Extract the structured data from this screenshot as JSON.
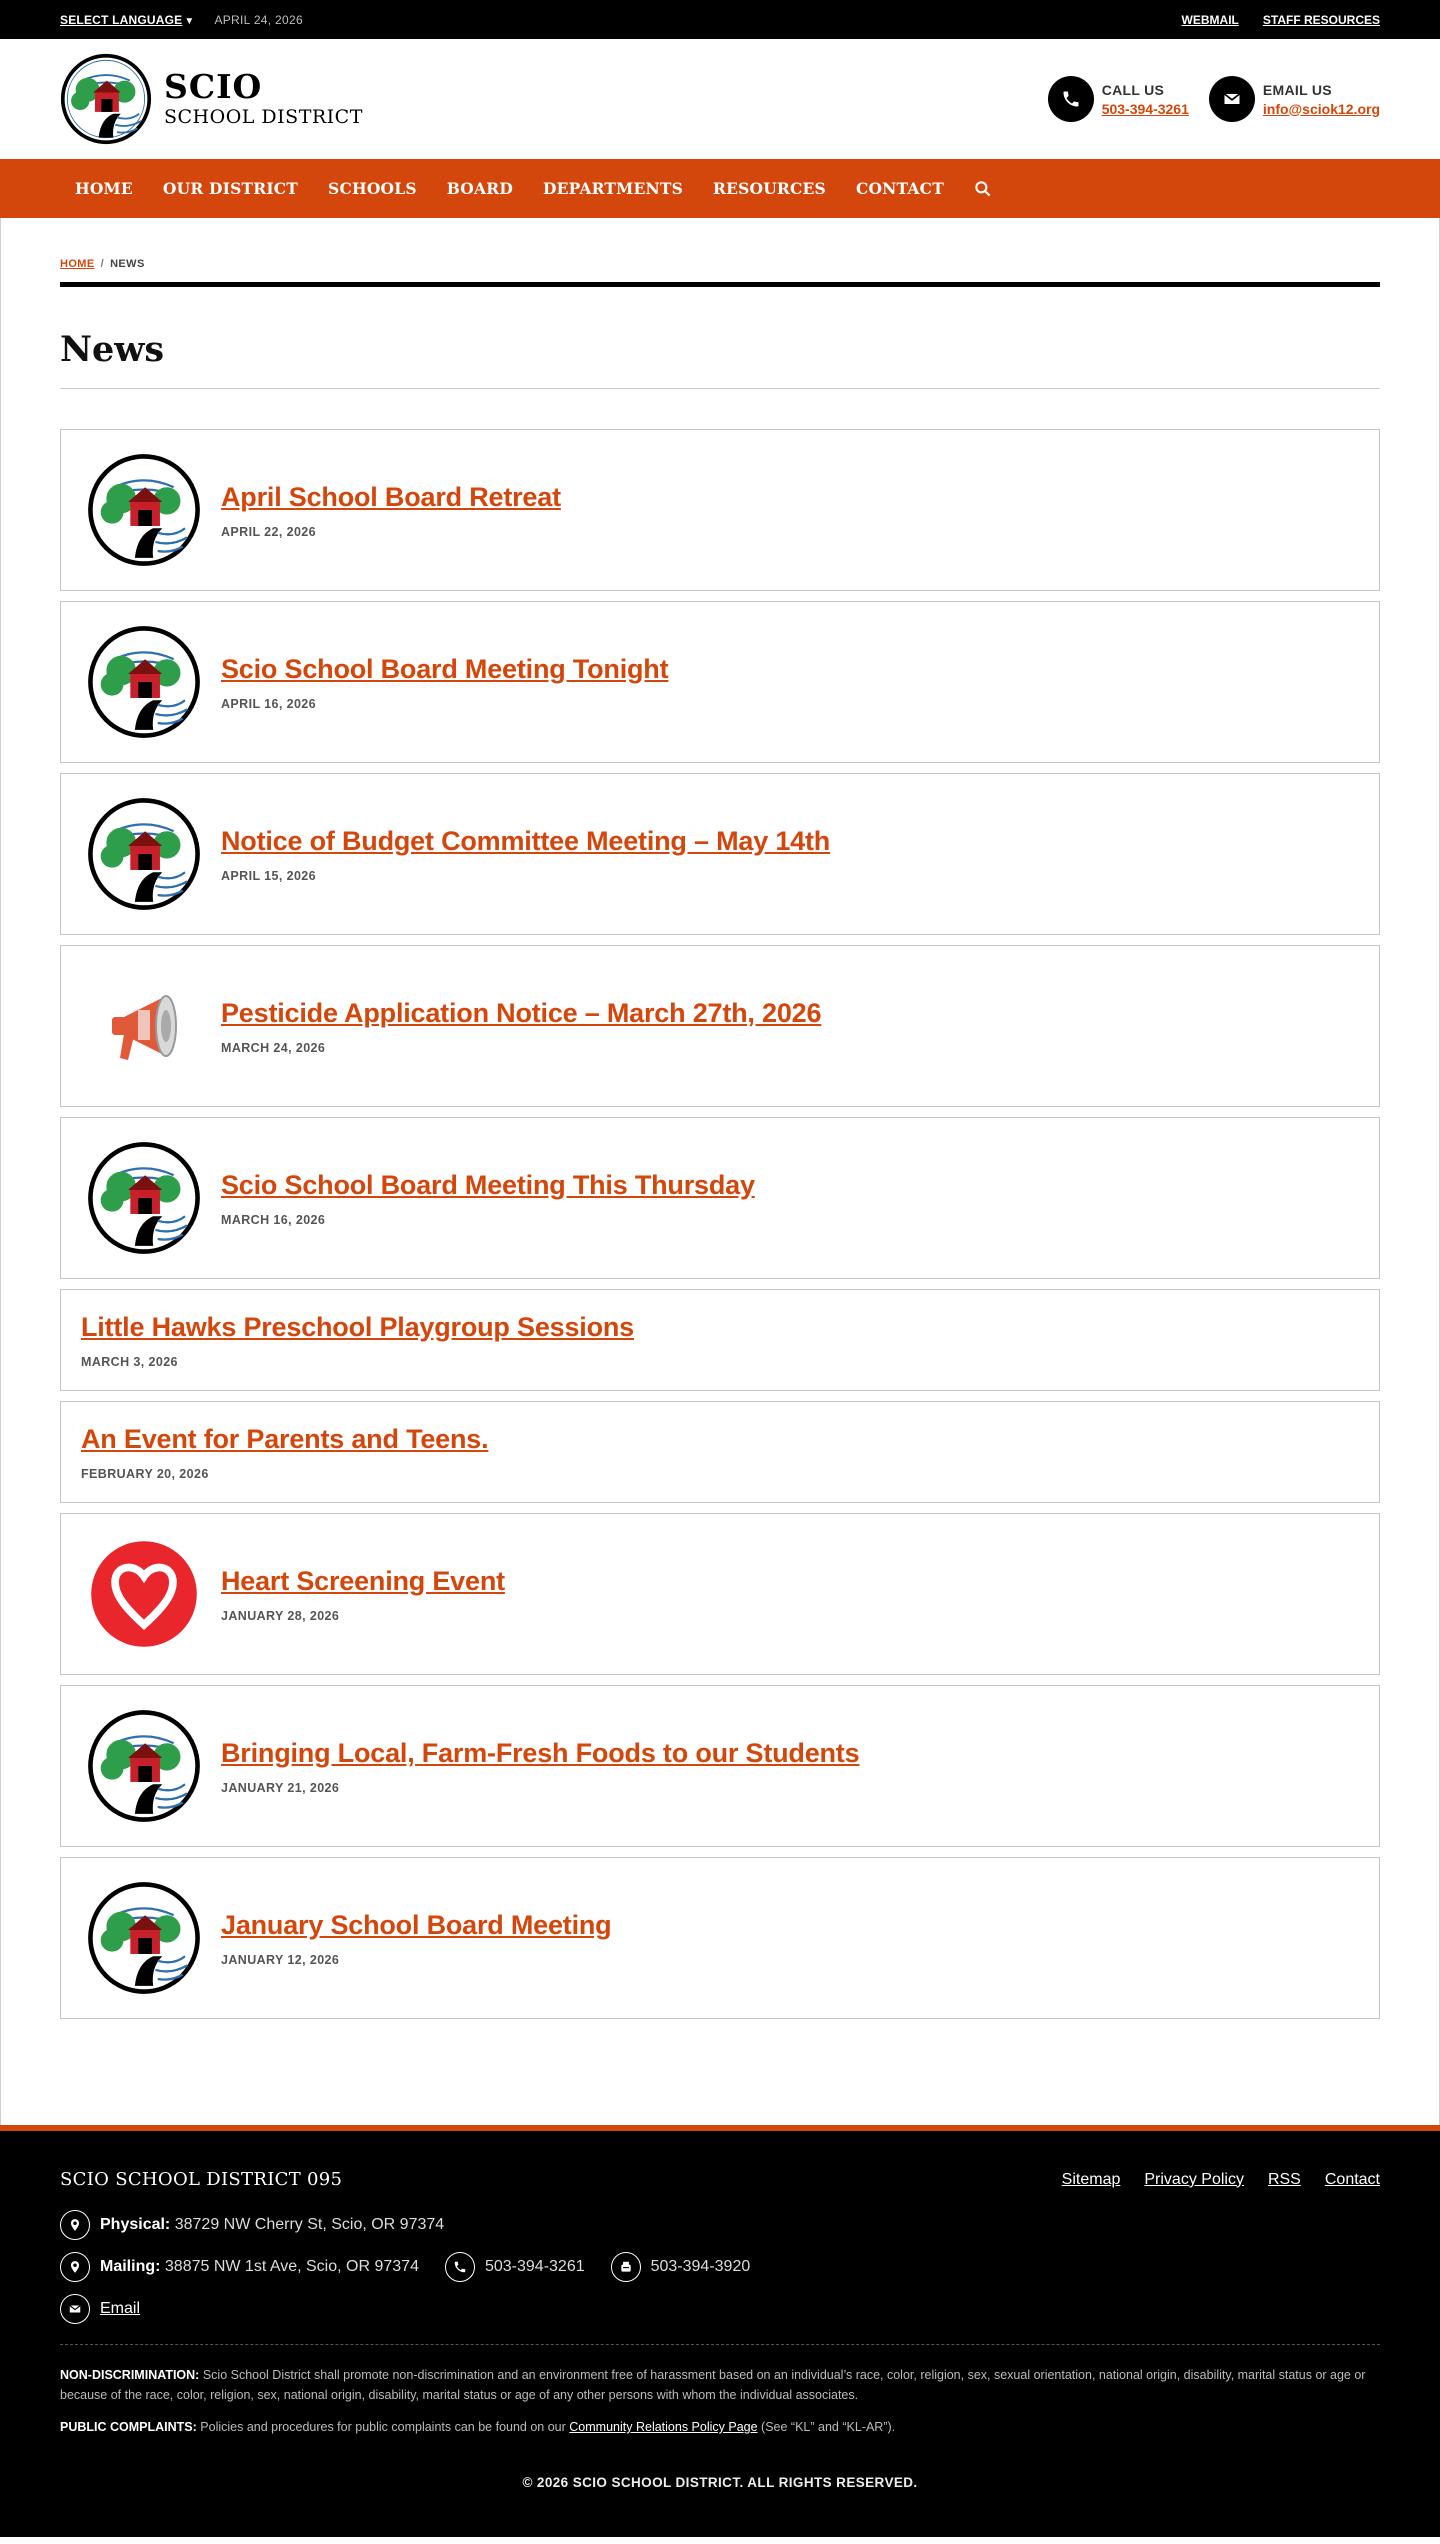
{
  "topbar": {
    "language_label": "SELECT LANGUAGE",
    "date": "APRIL 24, 2026",
    "links": [
      "WEBMAIL",
      "STAFF RESOURCES"
    ]
  },
  "header": {
    "name_line1": "SCIO",
    "name_line2": "SCHOOL DISTRICT",
    "call_label": "CALL US",
    "call_value": "503-394-3261",
    "email_label": "EMAIL US",
    "email_value": "info@sciok12.org"
  },
  "nav": {
    "items": [
      "HOME",
      "OUR DISTRICT",
      "SCHOOLS",
      "BOARD",
      "DEPARTMENTS",
      "RESOURCES",
      "CONTACT"
    ]
  },
  "breadcrumb": {
    "home": "HOME",
    "sep": "/",
    "current": "NEWS"
  },
  "page_title": "News",
  "news": [
    {
      "title": "April School Board Retreat",
      "date": "APRIL 22, 2026",
      "image": "district-logo"
    },
    {
      "title": "Scio School Board Meeting Tonight",
      "date": "APRIL 16, 2026",
      "image": "district-logo"
    },
    {
      "title": "Notice of Budget Committee Meeting – May 14th",
      "date": "APRIL 15, 2026",
      "image": "district-logo"
    },
    {
      "title": "Pesticide Application Notice – March 27th, 2026",
      "date": "MARCH 24, 2026",
      "image": "megaphone"
    },
    {
      "title": "Scio School Board Meeting This Thursday",
      "date": "MARCH 16, 2026",
      "image": "district-logo"
    },
    {
      "title": "Little Hawks Preschool Playgroup Sessions",
      "date": "MARCH 3, 2026",
      "image": ""
    },
    {
      "title": "An Event for Parents and Teens.",
      "date": "FEBRUARY 20, 2026",
      "image": ""
    },
    {
      "title": "Heart Screening Event",
      "date": "JANUARY 28, 2026",
      "image": "heart"
    },
    {
      "title": "Bringing Local, Farm-Fresh Foods to our Students",
      "date": "JANUARY 21, 2026",
      "image": "district-logo"
    },
    {
      "title": "January School Board Meeting",
      "date": "JANUARY 12, 2026",
      "image": "district-logo"
    }
  ],
  "footer": {
    "org": "SCIO SCHOOL DISTRICT 095",
    "links": [
      "Sitemap",
      "Privacy Policy",
      "RSS",
      "Contact"
    ],
    "physical_label": "Physical:",
    "physical_value": "38729 NW Cherry St, Scio, OR 97374",
    "mailing_label": "Mailing:",
    "mailing_value": "38875 NW 1st Ave, Scio, OR 97374",
    "phone": "503-394-3261",
    "fax": "503-394-3920",
    "email_link": "Email",
    "nondiscrimination_label": "NON-DISCRIMINATION:",
    "nondiscrimination_text": "Scio School District shall promote non-discrimination and an environment free of harassment based on an individual’s race, color, religion, sex, sexual orientation, national origin, disability, marital status or age or because of the race, color, religion, sex, national origin, disability, marital status or age of any other persons with whom the individual associates.",
    "complaints_label": "PUBLIC COMPLAINTS:",
    "complaints_text_before": "Policies and procedures for public complaints can be found on our",
    "complaints_link": "Community Relations Policy Page",
    "complaints_text_after": "(See “KL” and “KL-AR”).",
    "copyright": "© 2026 SCIO SCHOOL DISTRICT. ALL RIGHTS RESERVED."
  },
  "colors": {
    "accent": "#d4470c",
    "dark": "#000000"
  }
}
